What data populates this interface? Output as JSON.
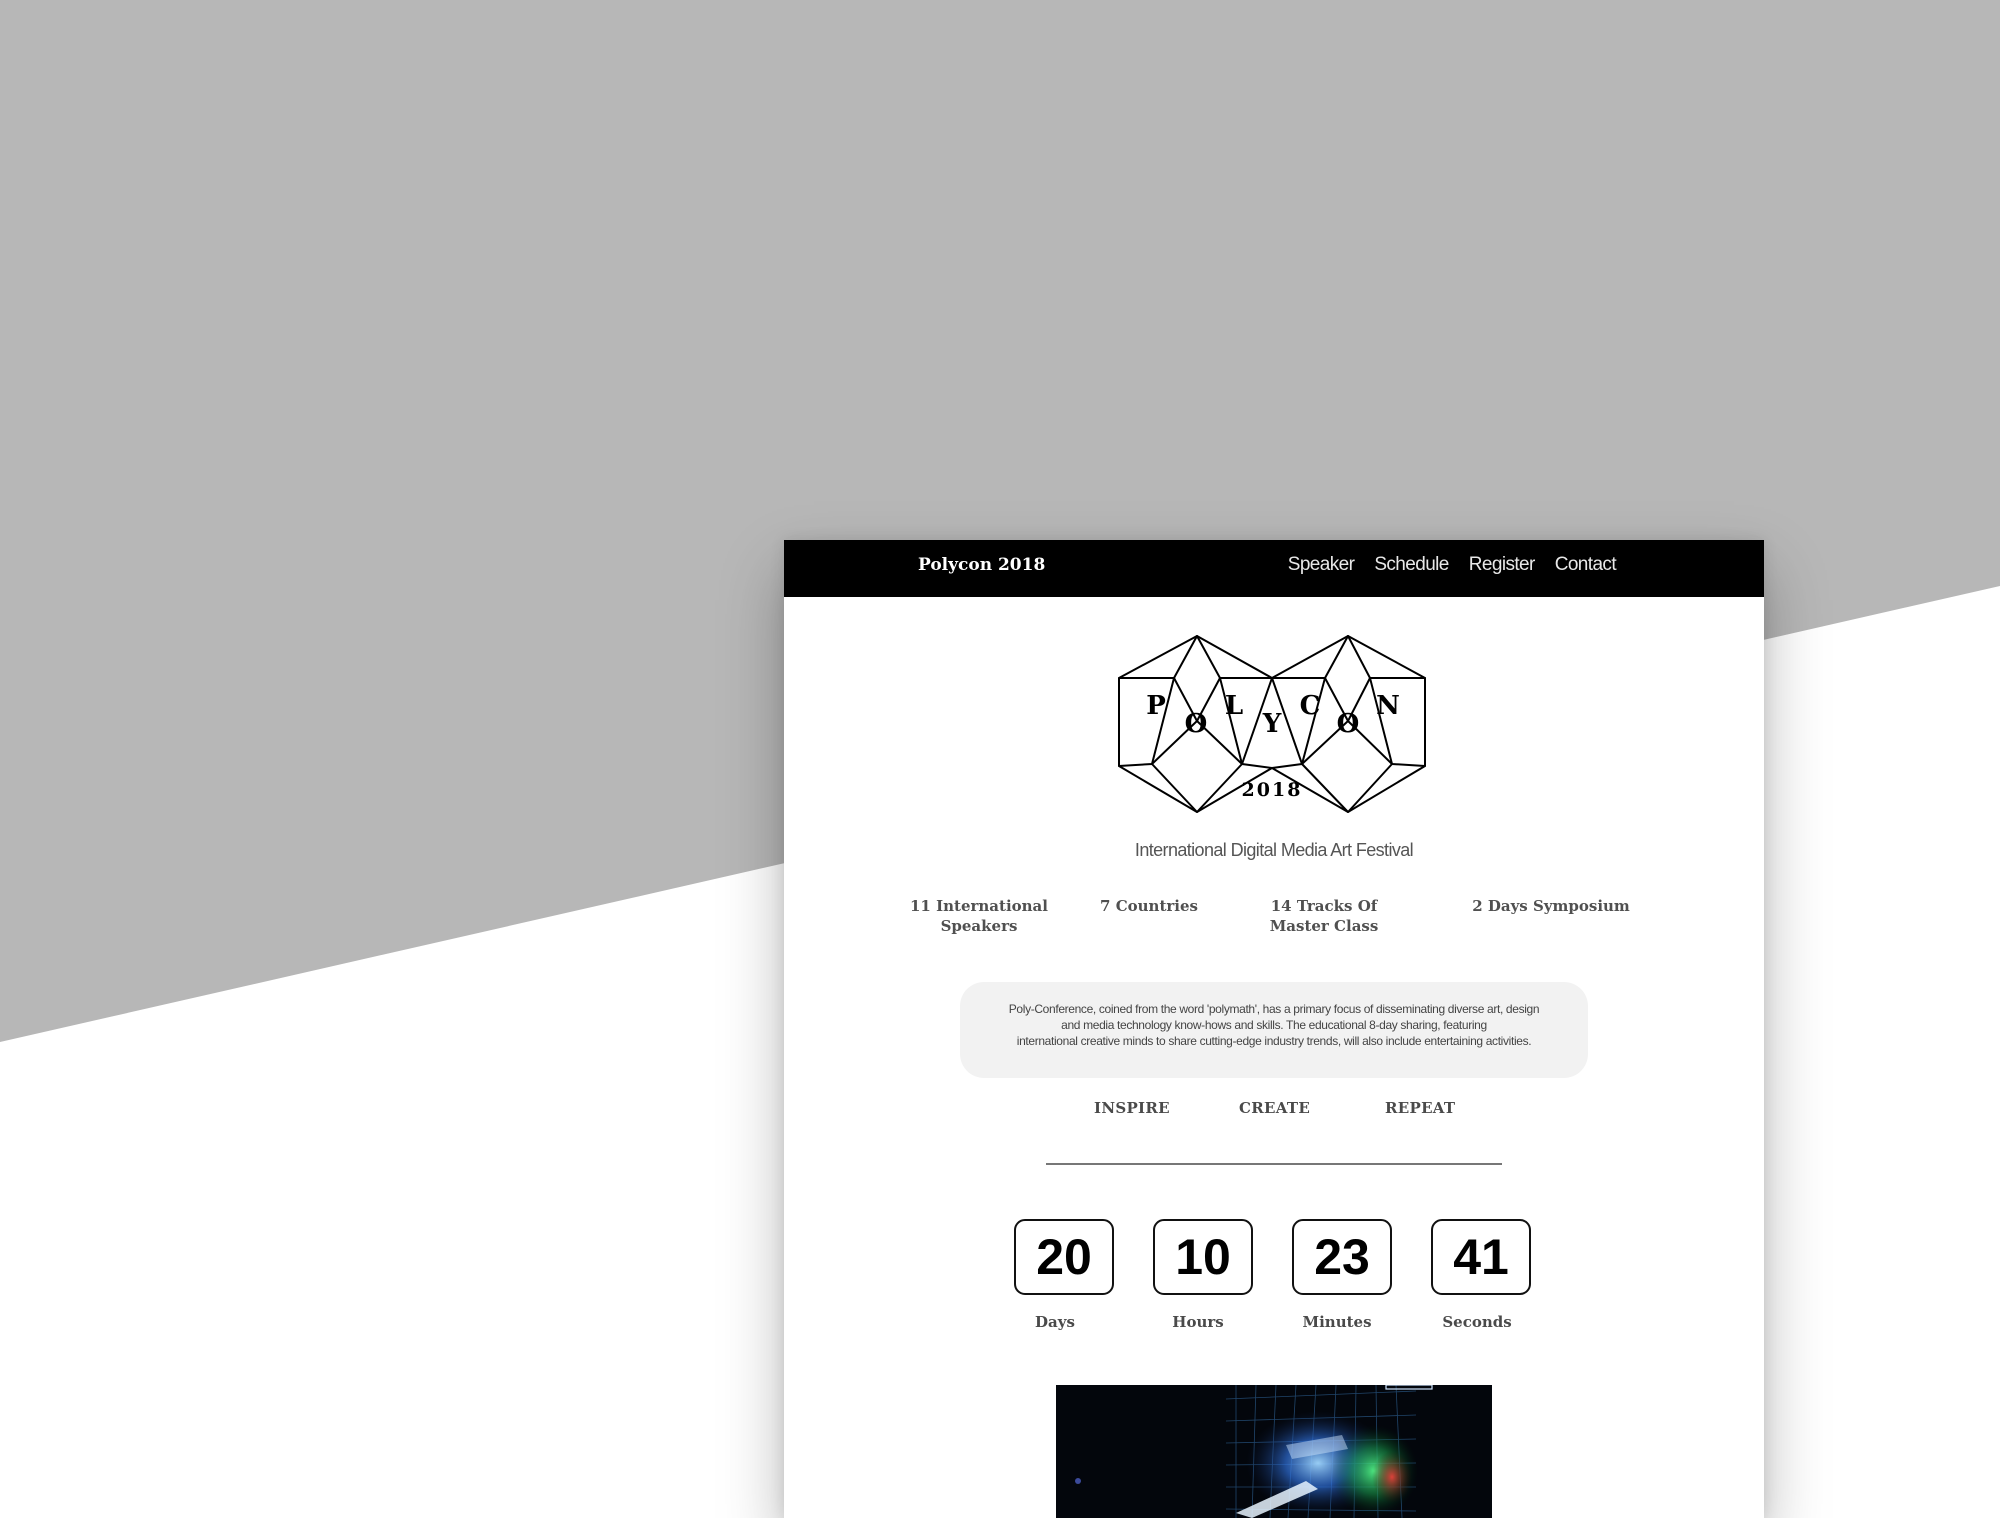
{
  "nav": {
    "brand": "Polycon 2018",
    "links": [
      "Speaker",
      "Schedule",
      "Register",
      "Contact"
    ]
  },
  "logo": {
    "letters": [
      "P",
      "O",
      "L",
      "Y",
      "C",
      "O",
      "N"
    ],
    "year": "2018"
  },
  "tagline": "International Digital Media Art Festival",
  "stats": [
    {
      "line1": "11 International",
      "line2": "Speakers"
    },
    {
      "line1": "7 Countries",
      "line2": ""
    },
    {
      "line1": "14 Tracks Of",
      "line2": "Master Class"
    },
    {
      "line1": "2 Days Symposium",
      "line2": ""
    }
  ],
  "blurb": {
    "line1": "Poly-Conference, coined from the word 'polymath', has a primary focus of disseminating diverse art, design",
    "line2": "and media technology know-hows and skills. The educational 8-day sharing, featuring",
    "line3": "international creative minds to share cutting-edge industry trends, will also include entertaining activities."
  },
  "motto": [
    "INSPIRE",
    "CREATE",
    "REPEAT"
  ],
  "countdown": [
    {
      "value": "20",
      "label": "Days"
    },
    {
      "value": "10",
      "label": "Hours"
    },
    {
      "value": "23",
      "label": "Minutes"
    },
    {
      "value": "41",
      "label": "Seconds"
    }
  ],
  "colors": {
    "background_gray": "#b7b7b7",
    "nav_background": "#000000",
    "blurb_background": "#f2f2f2"
  }
}
